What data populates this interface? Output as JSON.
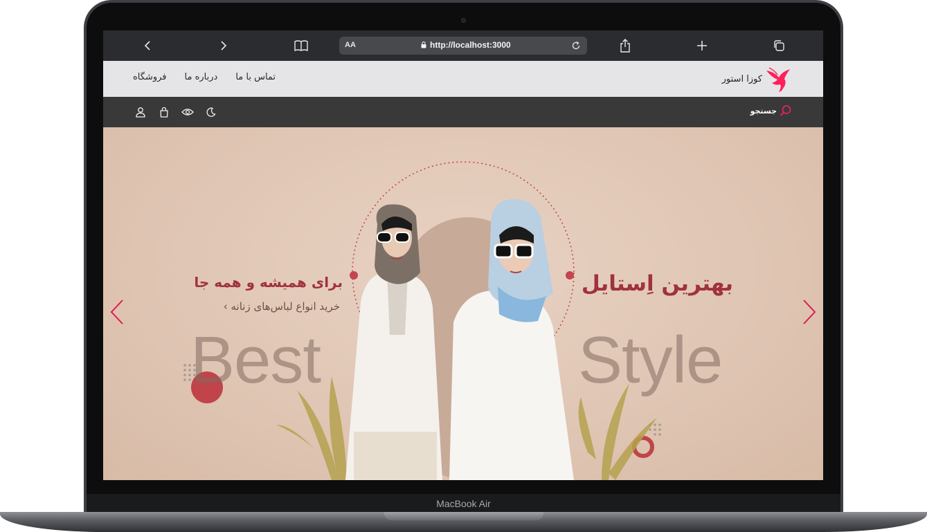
{
  "device": {
    "label": "MacBook Air"
  },
  "browser": {
    "text_size_label": "AA",
    "url": "http://localhost:3000",
    "icons": [
      "back-icon",
      "forward-icon",
      "bookmarks-icon",
      "lock-icon",
      "reload-icon",
      "share-icon",
      "new-tab-icon",
      "tabs-icon"
    ]
  },
  "site": {
    "brand": {
      "name": "کوزا استور",
      "logo": "bird-logo",
      "accent": "#ff1f5a"
    },
    "menu": [
      {
        "label": "فروشگاه"
      },
      {
        "label": "درباره ما"
      },
      {
        "label": "تماس با ما"
      }
    ],
    "search": {
      "label": "جستجو",
      "icon": "search-icon"
    },
    "tools": [
      "dark-mode-icon",
      "eye-icon",
      "cart-icon",
      "user-icon"
    ]
  },
  "hero": {
    "title_right": "بهترین اِستایل",
    "title_left": "برای همیشه و همه جا",
    "subtitle": "خرید انواع لباس‌های زنانه ›",
    "word_left": "Best",
    "word_right": "Style",
    "colors": {
      "title": "#a0323e",
      "arrow": "#e0194e"
    }
  }
}
